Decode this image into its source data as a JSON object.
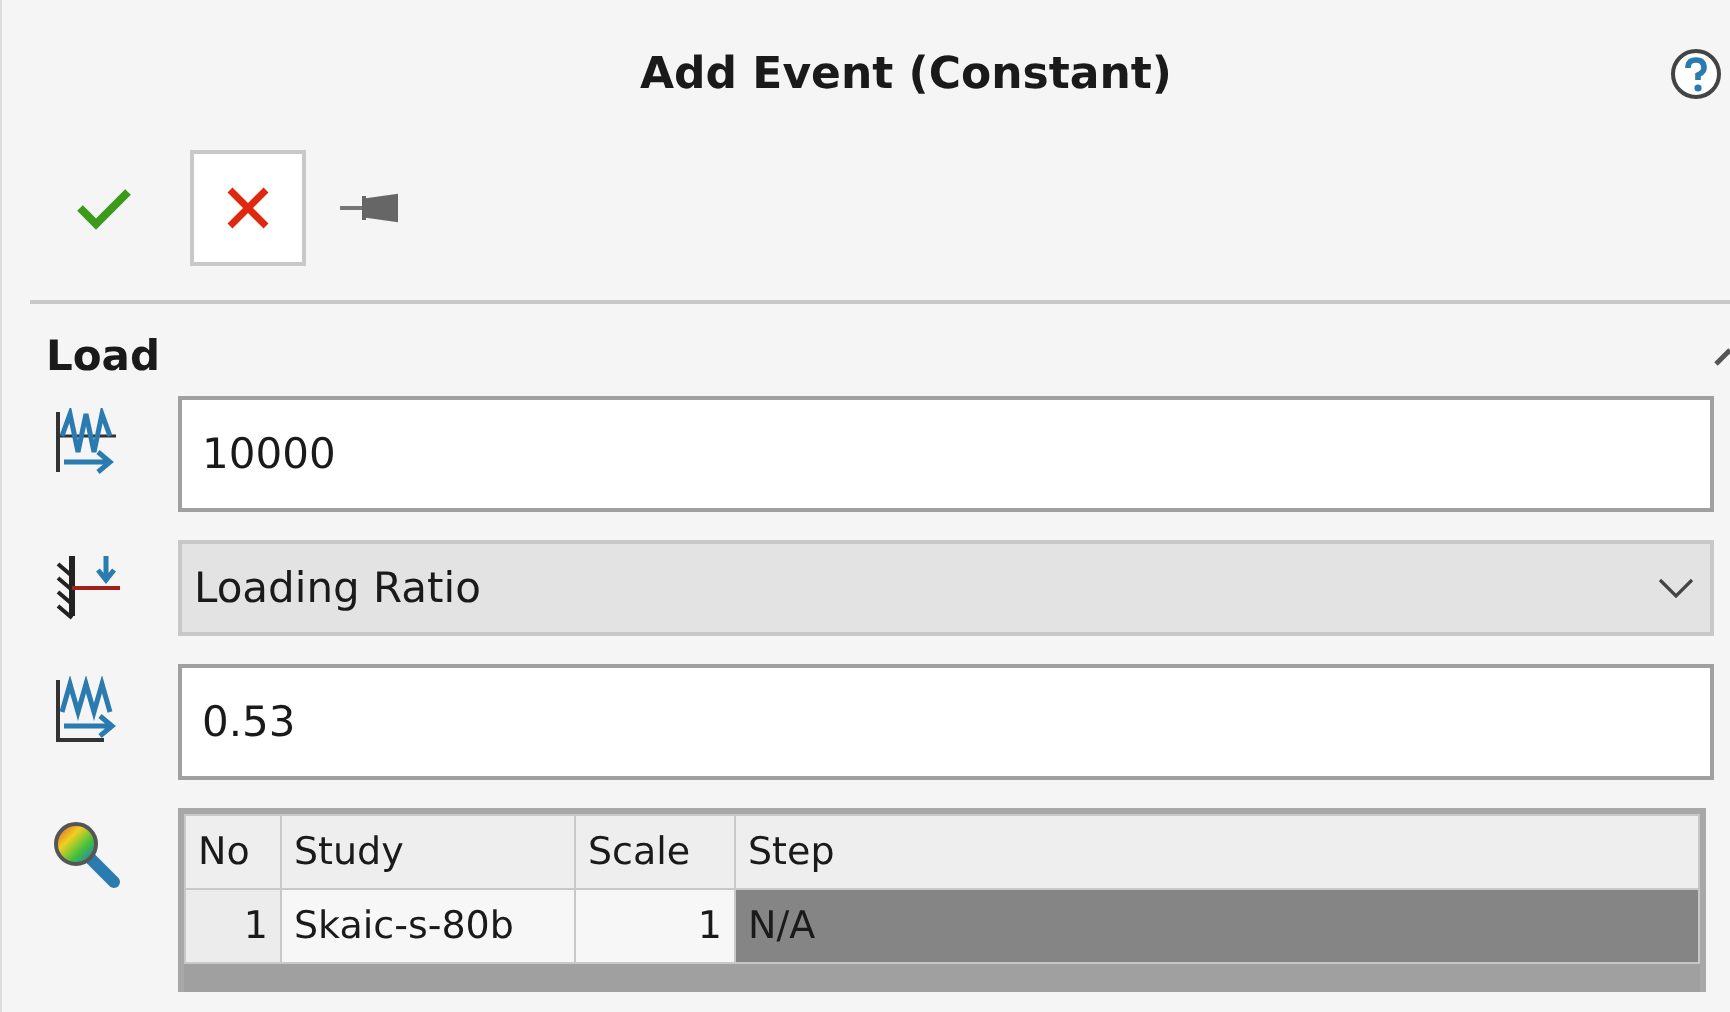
{
  "title": "Add Event (Constant)",
  "toolbar": [
    {
      "kind": "ok",
      "focused": false
    },
    {
      "kind": "cancel",
      "focused": true
    },
    {
      "kind": "pin",
      "focused": false
    }
  ],
  "section": {
    "title": "Load",
    "expanded": true
  },
  "fields": [
    {
      "kind": "input",
      "value": "10000"
    },
    {
      "kind": "dropdown",
      "value": "Loading Ratio"
    },
    {
      "kind": "input",
      "value": "0.53"
    }
  ],
  "table": {
    "columns": [
      "No",
      "Study",
      "Scale",
      "Step"
    ],
    "rows": [
      {
        "cells": [
          {
            "text": "1",
            "selected": false
          },
          {
            "text": "Skaic-s-80b",
            "selected": false
          },
          {
            "text": "1",
            "selected": false
          },
          {
            "text": "N/A",
            "selected": true
          }
        ]
      }
    ]
  }
}
